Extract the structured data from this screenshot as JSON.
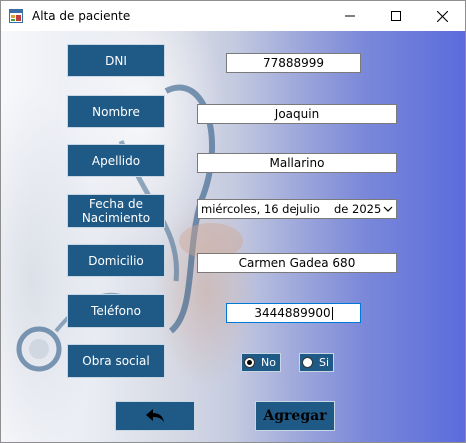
{
  "window": {
    "title": "Alta de paciente"
  },
  "titlebar": {
    "app_icon": "form-app-icon",
    "minimize_icon": "minimize-icon",
    "maximize_icon": "maximize-icon",
    "close_icon": "close-icon"
  },
  "form": {
    "dni": {
      "label": "DNI",
      "value": "77888999"
    },
    "nombre": {
      "label": "Nombre",
      "value": "Joaquin"
    },
    "apellido": {
      "label": "Apellido",
      "value": "Mallarino"
    },
    "fecha": {
      "label_line1": "Fecha de",
      "label_line2": "Nacimiento",
      "weekday_day": "miércoles, 16 de",
      "month": "julio",
      "year_part": "de 2025"
    },
    "domicilio": {
      "label": "Domicilio",
      "value": "Carmen Gadea 680"
    },
    "telefono": {
      "label": "Teléfono",
      "value": "3444889900"
    },
    "obra_social": {
      "label": "Obra social",
      "option_no": "No",
      "option_si": "Si",
      "selected": "No"
    }
  },
  "actions": {
    "back_icon": "back-arrow-icon",
    "agregar_label": "Agregar"
  },
  "colors": {
    "button_blue": "#1f5a86",
    "gradient_end": "#5b6bdc"
  }
}
